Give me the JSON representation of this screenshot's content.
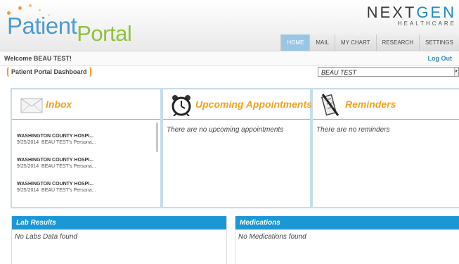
{
  "header": {
    "logo_word1": "Patient",
    "logo_word2": "Portal",
    "brand_name_part1": "NEXT",
    "brand_name_part2": "GEN",
    "brand_sub": "HEALTHCARE",
    "nav_tabs": [
      {
        "label": "HOME",
        "active": true
      },
      {
        "label": "MAIL",
        "active": false
      },
      {
        "label": "MY CHART",
        "active": false
      },
      {
        "label": "RESEARCH",
        "active": false
      },
      {
        "label": "SETTINGS",
        "active": false
      }
    ]
  },
  "welcome_bar": {
    "welcome_text": "Welcome BEAU TEST!",
    "logout_label": "Log Out"
  },
  "breadcrumb": {
    "label": "Patient Portal Dashboard"
  },
  "patient_select": {
    "value": "BEAU TEST"
  },
  "inbox": {
    "title": "Inbox",
    "messages": [
      {
        "from": "WASHINGTON COUNTY HOSPI...",
        "date": "9/25/2014",
        "subject": "BEAU TEST's Persona..."
      },
      {
        "from": "WASHINGTON COUNTY HOSPI...",
        "date": "9/25/2014",
        "subject": "BEAU TEST's Persona..."
      },
      {
        "from": "WASHINGTON COUNTY HOSPI...",
        "date": "9/25/2014",
        "subject": "BEAU TEST's Persona..."
      }
    ]
  },
  "appointments": {
    "title": "Upcoming Appointments",
    "empty_text": "There are no upcoming appointments"
  },
  "reminders": {
    "title": "Reminders",
    "empty_text": "There are no reminders"
  },
  "lab_results": {
    "title": "Lab Results",
    "empty_text": "No Labs Data found"
  },
  "medications": {
    "title": "Medications",
    "empty_text": "No Medications found"
  },
  "colors": {
    "accent_blue": "#1b97d5",
    "title_orange": "#f3a21d",
    "logo_blue": "#4f9bcf",
    "logo_green": "#8fc03c",
    "active_tab": "#9ac6e5"
  },
  "icons": [
    "envelope-icon",
    "alarm-clock-icon",
    "reminder-scroll-icon"
  ]
}
